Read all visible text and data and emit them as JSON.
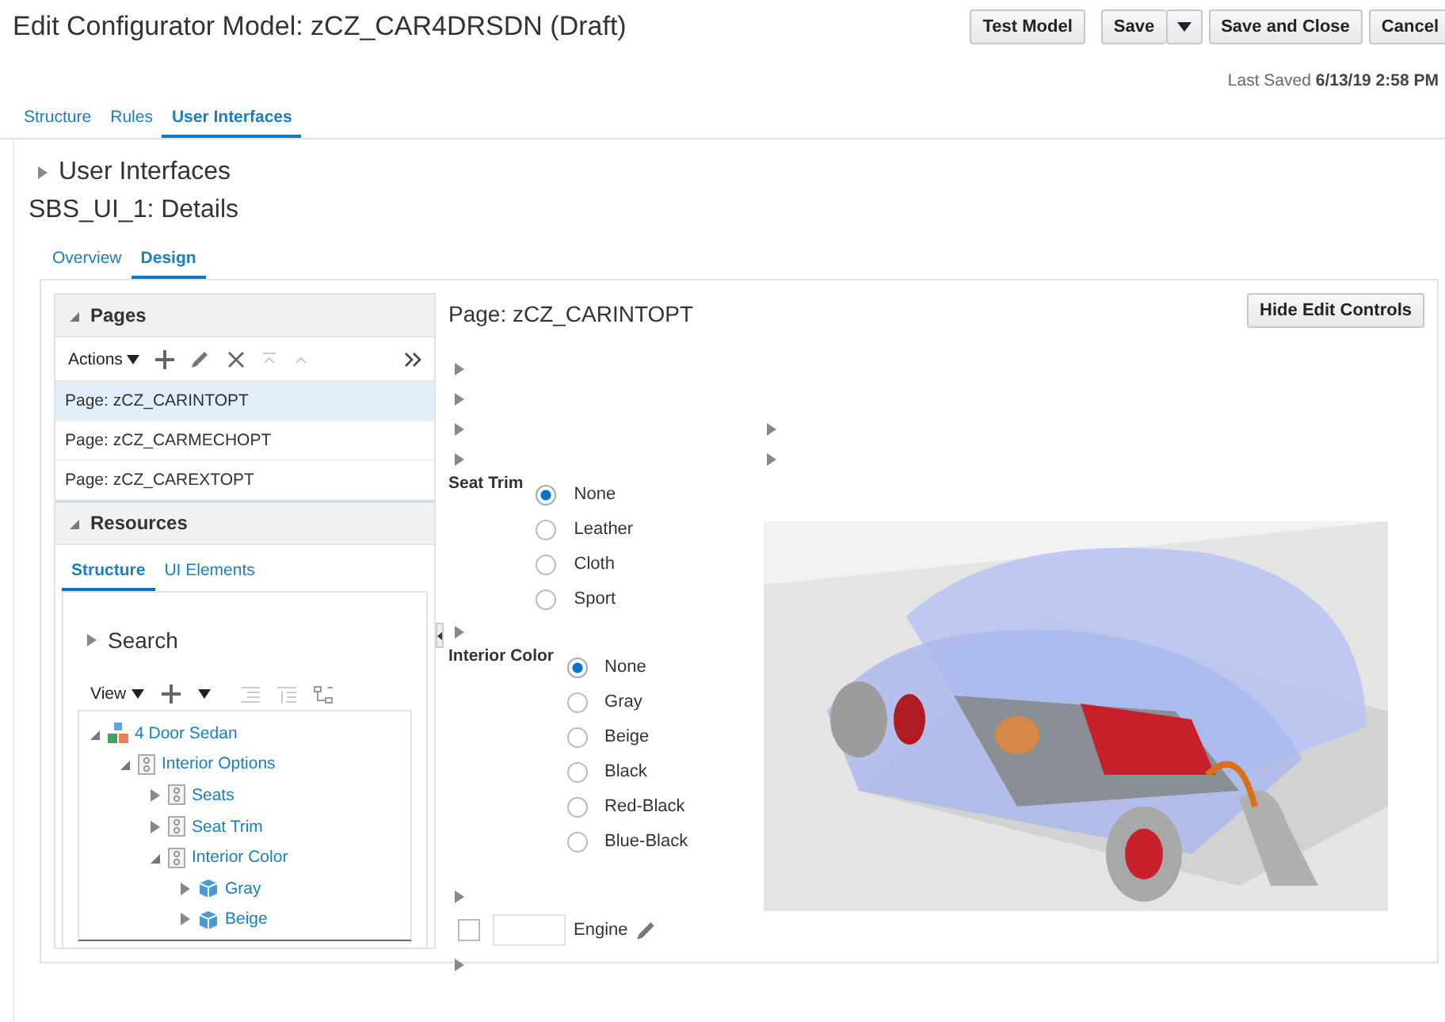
{
  "header": {
    "title": "Edit Configurator Model: zCZ_CAR4DRSDN (Draft)",
    "buttons": [
      {
        "label": "Test Model",
        "kind": "button"
      },
      {
        "label": "Save",
        "kind": "split"
      },
      {
        "label": "Save and Close",
        "kind": "button"
      },
      {
        "label": "Cancel",
        "kind": "button"
      }
    ]
  },
  "last_saved": {
    "label": "Last Saved",
    "value": "6/13/19 2:58 PM"
  },
  "tabs": [
    {
      "label": "Structure",
      "selected": false
    },
    {
      "label": "Rules",
      "selected": false
    },
    {
      "label": "User Interfaces",
      "selected": true
    }
  ],
  "breadcrumb": {
    "label": "User Interfaces",
    "expanded": false
  },
  "details_title": "SBS_UI_1: Details",
  "subtabs": [
    {
      "label": "Overview",
      "selected": false
    },
    {
      "label": "Design",
      "selected": true
    }
  ],
  "pages_panel": {
    "title": "Pages",
    "expanded": true,
    "actions_label": "Actions",
    "pages": [
      {
        "label": "Page: zCZ_CARINTOPT",
        "selected": true
      },
      {
        "label": "Page: zCZ_CARMECHOPT",
        "selected": false
      },
      {
        "label": "Page: zCZ_CAREXTOPT",
        "selected": false
      }
    ]
  },
  "resources_panel": {
    "title": "Resources",
    "expanded": true,
    "tabs": [
      {
        "label": "Structure",
        "selected": true
      },
      {
        "label": "UI Elements",
        "selected": false
      }
    ],
    "search": {
      "label": "Search",
      "expanded": false
    },
    "view_label": "View",
    "tree": [
      {
        "label": "4 Door Sedan",
        "kind": "model",
        "expanded": true,
        "children": [
          {
            "label": "Interior Options",
            "kind": "group",
            "expanded": true,
            "children": [
              {
                "label": "Seats",
                "kind": "group",
                "expanded": false
              },
              {
                "label": "Seat Trim",
                "kind": "group",
                "expanded": false
              },
              {
                "label": "Interior Color",
                "kind": "group",
                "expanded": true,
                "children": [
                  {
                    "label": "Gray",
                    "kind": "option",
                    "expanded": false
                  },
                  {
                    "label": "Beige",
                    "kind": "option",
                    "expanded": false
                  }
                ]
              }
            ]
          }
        ]
      }
    ]
  },
  "canvas": {
    "title": "Page: zCZ_CARINTOPT",
    "hide_button": "Hide Edit Controls",
    "groups": [
      {
        "label": "Seat Trim",
        "options": [
          {
            "label": "None",
            "selected": true
          },
          {
            "label": "Leather",
            "selected": false
          },
          {
            "label": "Cloth",
            "selected": false
          },
          {
            "label": "Sport",
            "selected": false
          }
        ]
      },
      {
        "label": "Interior Color",
        "options": [
          {
            "label": "None",
            "selected": true
          },
          {
            "label": "Gray",
            "selected": false
          },
          {
            "label": "Beige",
            "selected": false
          },
          {
            "label": "Black",
            "selected": false
          },
          {
            "label": "Red-Black",
            "selected": false
          },
          {
            "label": "Blue-Black",
            "selected": false
          }
        ]
      }
    ],
    "engine": {
      "label": "Engine",
      "checked": false
    }
  }
}
